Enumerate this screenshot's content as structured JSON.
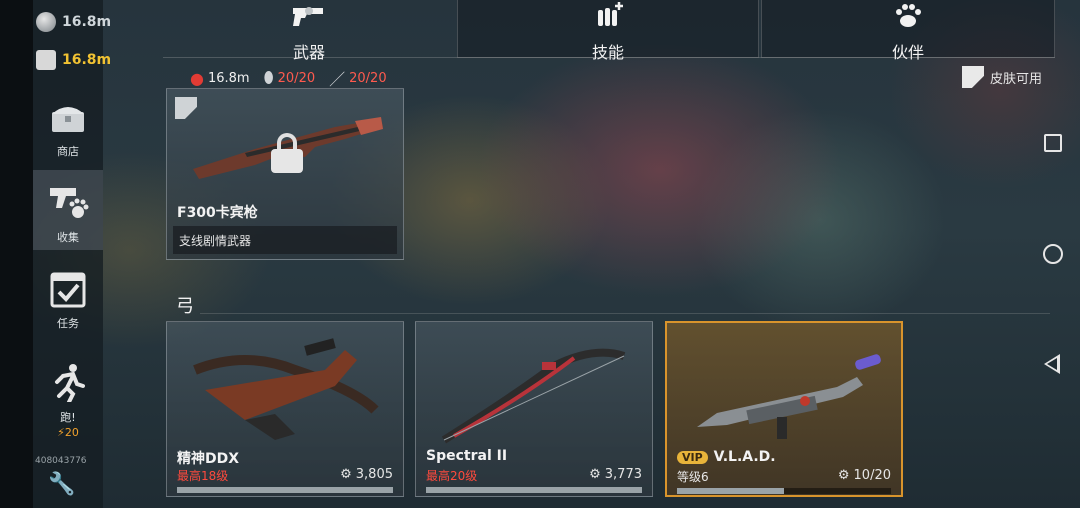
{
  "resources": {
    "res1": "16.8m",
    "res2": "16.8m"
  },
  "sidebar": {
    "items": [
      {
        "label": "商店",
        "icon": "chest-icon"
      },
      {
        "label": "收集",
        "icon": "gun-paw-icon"
      },
      {
        "label": "任务",
        "icon": "calendar-check-icon"
      },
      {
        "label": "跑!",
        "icon": "runner-icon",
        "sub": "20"
      }
    ],
    "uid": "408043776"
  },
  "tabs": [
    {
      "label": "武器",
      "icon": "revolver-icon"
    },
    {
      "label": "技能",
      "icon": "ammo-plus-icon"
    },
    {
      "label": "伙伴",
      "icon": "paw-icon"
    }
  ],
  "stats": [
    {
      "value": "16.8m",
      "icon": "fist-token-icon"
    },
    {
      "value": "20/20",
      "icon": "grenade-icon"
    },
    {
      "value": "20/20",
      "icon": "knife-icon"
    }
  ],
  "skin_available": "皮肤可用",
  "locked_weapon": {
    "name": "F300卡宾枪",
    "tag": "支线剧情武器"
  },
  "section_title": "弓",
  "bows": [
    {
      "name": "精神DDX",
      "sub": "最高18级",
      "power": "3,805",
      "progress": 1.0
    },
    {
      "name": "Spectral II",
      "sub": "最高20级",
      "power": "3,773",
      "progress": 1.0
    },
    {
      "name": "V.L.A.D.",
      "sub": "等级6",
      "power": "10/20",
      "progress": 0.5,
      "badge": "VIP"
    }
  ],
  "colors": {
    "accent_red": "#ff4a3d",
    "gold": "#f1c232",
    "vip_border": "#d9942c"
  }
}
